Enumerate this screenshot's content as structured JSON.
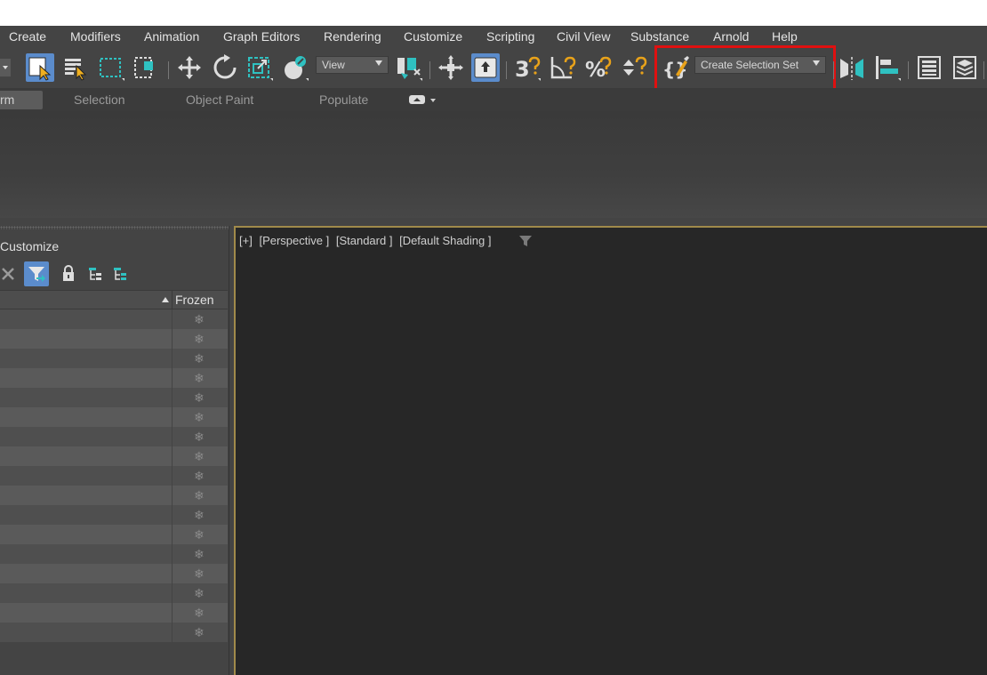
{
  "menu": [
    "Create",
    "Modifiers",
    "Animation",
    "Graph Editors",
    "Rendering",
    "Customize",
    "Scripting",
    "Civil View",
    "Substance",
    "Arnold",
    "Help"
  ],
  "toolbar": {
    "view_dropdown": "View",
    "selection_set_dropdown": "Create Selection Set"
  },
  "ribbon_tabs": [
    "rm",
    "Selection",
    "Object Paint",
    "Populate"
  ],
  "explorer": {
    "title": "Customize",
    "column_frozen": "Frozen",
    "frozen_glyph": "❄",
    "row_count": 17
  },
  "viewport": {
    "labels": [
      "[+]",
      "[Perspective ]",
      "[Standard ]",
      "[Default Shading ]"
    ]
  },
  "colors": {
    "highlight": "#e01010",
    "active_blue": "#5b8ccc",
    "teal": "#2fc1c1",
    "orange": "#e8a21a"
  }
}
